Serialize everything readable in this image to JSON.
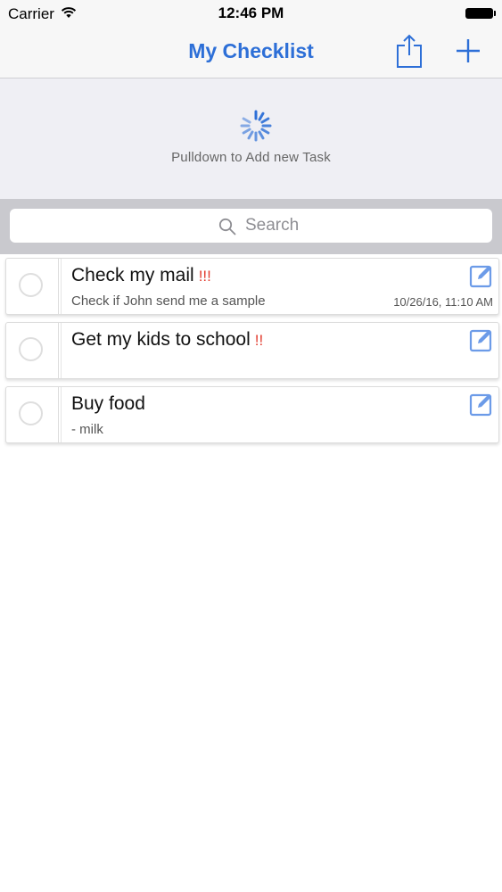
{
  "status_bar": {
    "carrier": "Carrier",
    "time": "12:46 PM"
  },
  "nav": {
    "title": "My Checklist",
    "share_icon": "share-icon",
    "add_icon": "plus-icon",
    "accent_color": "#2d6fd7"
  },
  "refresh": {
    "text": "Pulldown to Add new Task",
    "icon": "spinner-icon"
  },
  "search": {
    "placeholder": "Search"
  },
  "tasks": [
    {
      "title": "Check my mail",
      "priority": "!!!",
      "note": "Check if John send me a sample",
      "date": "10/26/16, 11:10 AM",
      "completed": false
    },
    {
      "title": "Get my kids to school",
      "priority": "!!",
      "note": "",
      "date": "",
      "completed": false
    },
    {
      "title": "Buy food",
      "priority": "",
      "note": "- milk",
      "date": "",
      "completed": false
    }
  ],
  "colors": {
    "priority": "#e23b2e",
    "edit_icon": "#6c9be8"
  }
}
